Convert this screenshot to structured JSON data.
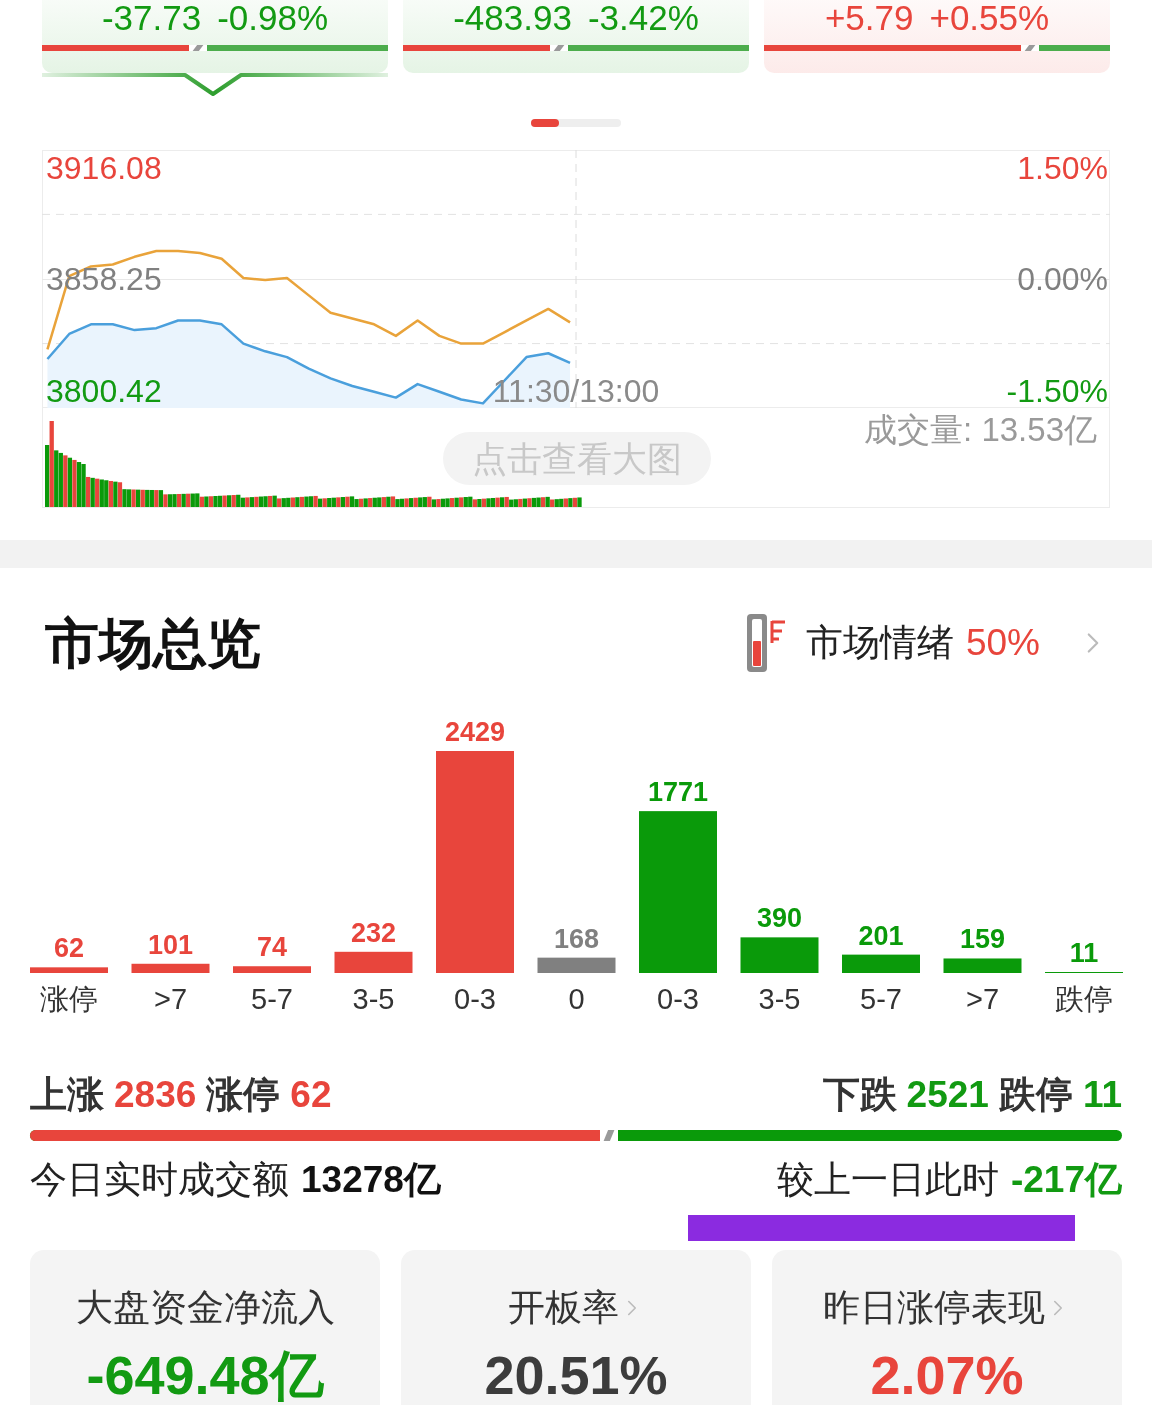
{
  "index_cards": [
    {
      "change": "-37.73",
      "percent": "-0.98%",
      "color": "#129a12",
      "level": 0.45,
      "selected": true
    },
    {
      "change": "-483.93",
      "percent": "-3.42%",
      "color": "#129a12",
      "level": 0.45,
      "selected": false
    },
    {
      "change": "+5.79",
      "percent": "+0.55%",
      "color": "#e8453c",
      "level": 0.77,
      "selected": false
    }
  ],
  "intraday_chart": {
    "chart_data": {
      "type": "line",
      "ylim": [
        3791.6,
        3925.4
      ],
      "yticks": [
        {
          "value": 3916.08,
          "label": "3916.08"
        },
        {
          "value": 3858.25,
          "label": "3858.25"
        },
        {
          "value": 3800.42,
          "label": "3800.42"
        }
      ],
      "ref_lines": [
        {
          "axis": "y",
          "value": 3892
        },
        {
          "axis": "y",
          "value": 3858.25
        },
        {
          "axis": "y",
          "value": 3825
        }
      ],
      "annotations": [
        "11:30/13:00"
      ],
      "series": [
        {
          "color": "#e9a33a",
          "values": [
            3822,
            3860,
            3865,
            3866,
            3870,
            3873,
            3873,
            3872,
            3869,
            3859,
            3858,
            3859,
            3850,
            3841,
            3838,
            3835,
            3829,
            3837,
            3829,
            3825,
            3825,
            3831,
            3837,
            3843,
            3836,
            null,
            null,
            null,
            null,
            null,
            null,
            null,
            null,
            null,
            null,
            null,
            null,
            null,
            null,
            null,
            null,
            null,
            null,
            null,
            null,
            null,
            null,
            null,
            null
          ]
        },
        {
          "color": "#4a9fdc",
          "values": [
            3817,
            3830,
            3835,
            3835,
            3832,
            3833,
            3837,
            3837,
            3835,
            3825,
            3821,
            3818,
            3812,
            3807,
            3803,
            3800,
            3797,
            3804,
            3800,
            3796,
            3794,
            3806,
            3818,
            3820,
            3815,
            null,
            null,
            null,
            null,
            null,
            null,
            null,
            null,
            null,
            null,
            null,
            null,
            null,
            null,
            null,
            null,
            null,
            null,
            null,
            null,
            null,
            null,
            null,
            null
          ]
        }
      ]
    },
    "right_axis_labels": [
      "1.50%",
      "0.00%",
      "-1.50%"
    ],
    "volume_label": "成交量: 13.53亿",
    "enlarge_button": "点击查看大图"
  },
  "market_overview": {
    "title": "市场总览",
    "sentiment": {
      "label": "市场情绪",
      "value": "50%"
    },
    "distribution": {
      "chart_data": {
        "type": "bar",
        "stacked": true,
        "data_labels": true,
        "categories": [
          "涨停",
          ">7",
          "5-7",
          "3-5",
          "0-3",
          "0",
          "0-3",
          "3-5",
          "5-7",
          ">7",
          "跌停"
        ],
        "series": [
          {
            "color": "#e8453c",
            "values": [
              62,
              101,
              74,
              232,
              2429,
              null,
              null,
              null,
              null,
              null,
              null
            ]
          },
          {
            "color": "#808080",
            "values": [
              null,
              null,
              null,
              null,
              null,
              168,
              null,
              null,
              null,
              null,
              null
            ]
          },
          {
            "color": "#0a9a0a",
            "values": [
              null,
              null,
              null,
              null,
              null,
              null,
              1771,
              390,
              201,
              159,
              11
            ]
          }
        ]
      }
    },
    "breadth": {
      "advance": {
        "label": "上涨",
        "count": "2836",
        "limit_label": "涨停",
        "limit_count": "62"
      },
      "decline": {
        "label": "下跌",
        "count": "2521",
        "limit_label": "跌停",
        "limit_count": "11"
      },
      "level": 0.53
    },
    "turnover": {
      "label": "今日实时成交额",
      "value": "13278亿"
    },
    "comparison": {
      "label": "较上一日此时",
      "value": "-217亿"
    }
  },
  "stat_cards": [
    {
      "title": "大盘资金净流入",
      "value": "-649.48亿",
      "color": "#129a12",
      "link": false
    },
    {
      "title": "开板率",
      "value": "20.51%",
      "color": "#3c3c3c",
      "link": true
    },
    {
      "title": "昨日涨停表现",
      "value": "2.07%",
      "color": "#e8453c",
      "link": true
    }
  ]
}
